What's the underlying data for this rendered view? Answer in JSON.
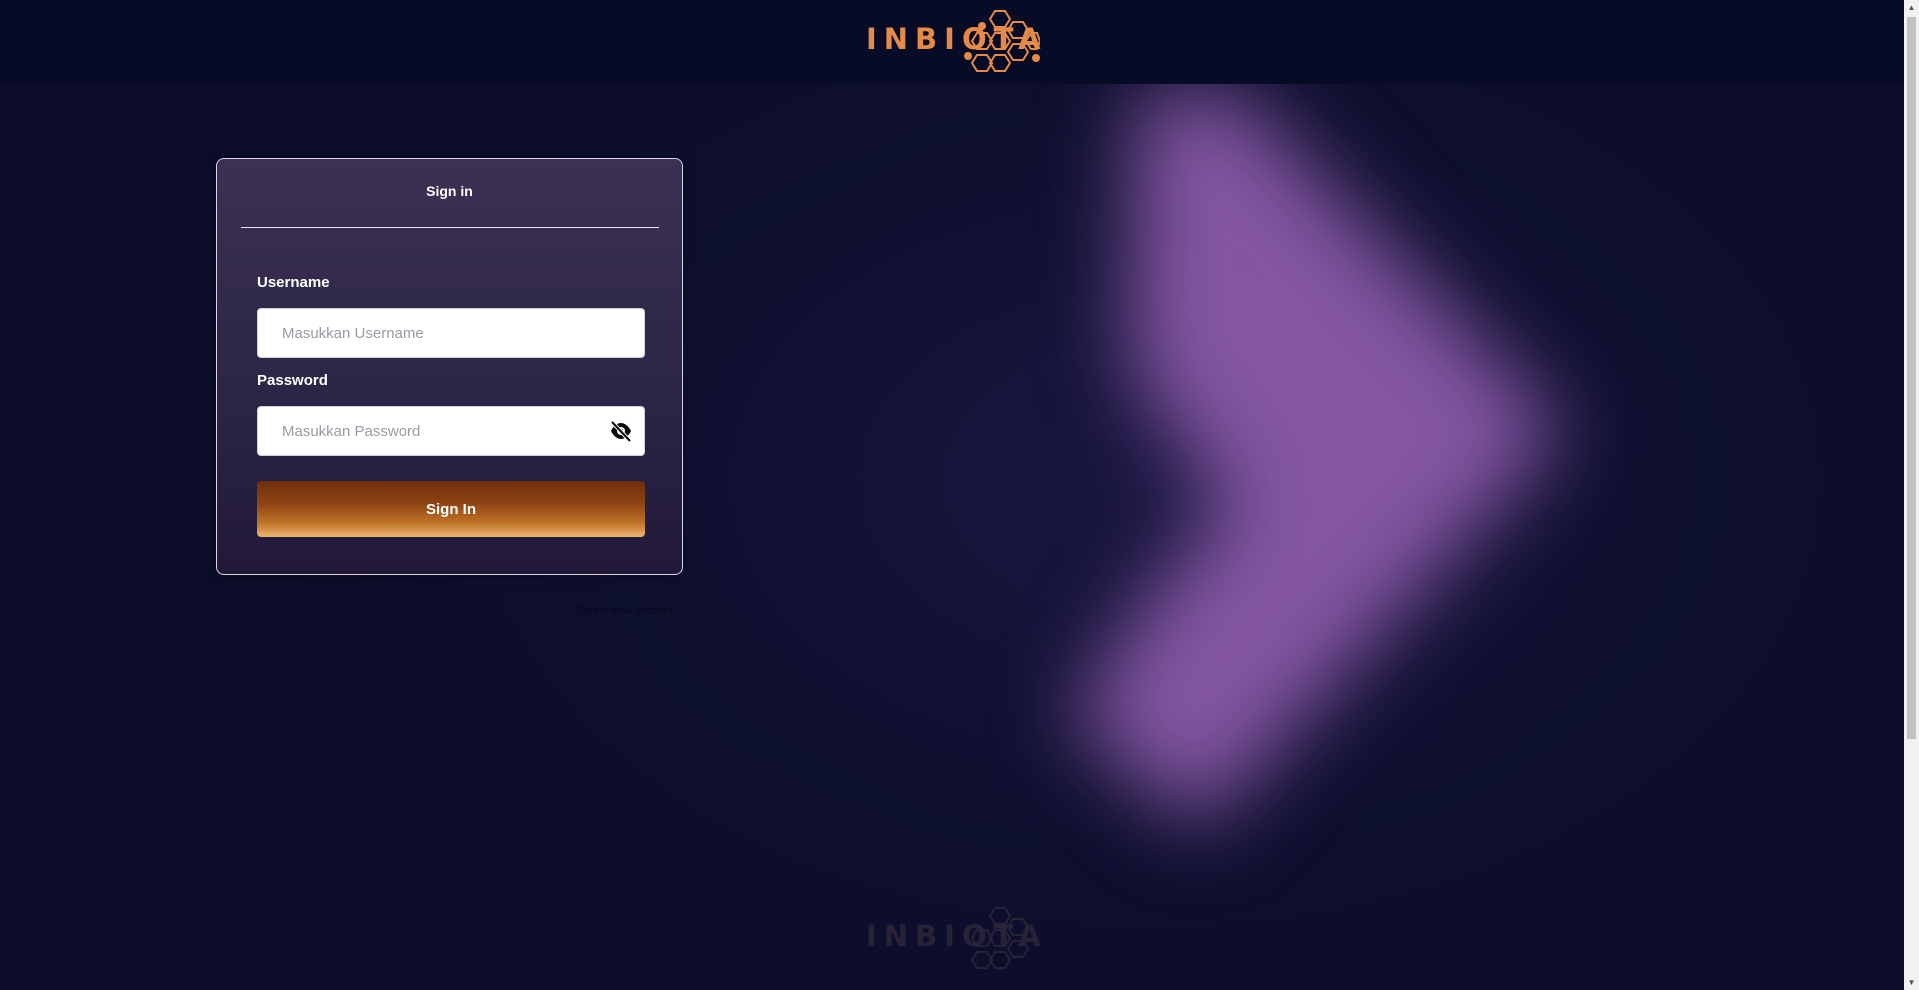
{
  "header": {
    "logo_text": "INBIOTA",
    "logo_color": "#e58a48"
  },
  "signin": {
    "title": "Sign in",
    "username_label": "Username",
    "username_placeholder": "Masukkan Username",
    "password_label": "Password",
    "password_placeholder": "Masukkan Password",
    "toggle_icon": "eye-slash-icon",
    "submit_label": "Sign In"
  },
  "links": {
    "create_account": "Create new account"
  },
  "footer": {
    "logo_text": "INBIOTA"
  },
  "colors": {
    "page_background": "#0c0e2b",
    "header_background": "#070b25",
    "glow": "#8a5aa8",
    "button_gradient_top": "#6e2e0c",
    "button_gradient_bottom": "#ecb573"
  }
}
